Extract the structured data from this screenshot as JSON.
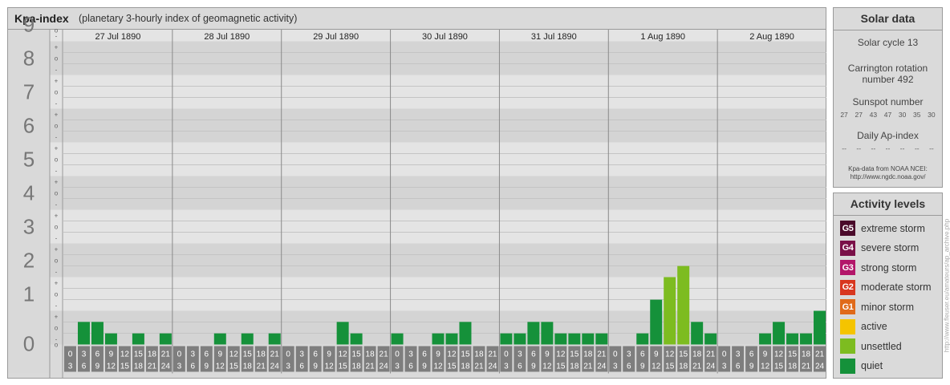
{
  "header": {
    "title": "Kpa-index",
    "subtitle": "(planetary 3-hourly index of geomagnetic activity)"
  },
  "chart_data": {
    "type": "bar",
    "ylim": [
      0,
      9
    ],
    "y_tick_labels": [
      "0",
      "1",
      "2",
      "3",
      "4",
      "5",
      "6",
      "7",
      "8",
      "9"
    ],
    "sub_tick_labels": [
      "-",
      "o",
      "+"
    ],
    "day_labels": [
      "27 Jul 1890",
      "28 Jul 1890",
      "29 Jul 1890",
      "30 Jul 1890",
      "31 Jul 1890",
      "1 Aug 1890",
      "2 Aug 1890"
    ],
    "interval_start_labels": [
      "0",
      "3",
      "6",
      "9",
      "12",
      "15",
      "18",
      "21"
    ],
    "interval_end_labels": [
      "3",
      "6",
      "9",
      "12",
      "15",
      "18",
      "21",
      "24"
    ],
    "values": [
      [
        0,
        0.67,
        0.67,
        0.33,
        0,
        0.33,
        0,
        0.33
      ],
      [
        0,
        0,
        0,
        0.33,
        0,
        0.33,
        0,
        0.33
      ],
      [
        0,
        0,
        0,
        0,
        0.67,
        0.33,
        0,
        0
      ],
      [
        0.33,
        0,
        0,
        0.33,
        0.33,
        0.67,
        0,
        0
      ],
      [
        0.33,
        0.33,
        0.67,
        0.67,
        0.33,
        0.33,
        0.33,
        0.33
      ],
      [
        0,
        0,
        0.33,
        1.33,
        2,
        2.33,
        0.67,
        0.33
      ],
      [
        0,
        0,
        0,
        0.33,
        0.67,
        0.33,
        0.33,
        1
      ]
    ],
    "level_colors": {
      "quiet": "#15913a",
      "unsettled": "#7dbc20"
    },
    "grid": true
  },
  "solar": {
    "title": "Solar data",
    "solar_cycle": "Solar cycle 13",
    "carrington_line1": "Carrington rotation",
    "carrington_line2": "number 492",
    "sunspot_label": "Sunspot number",
    "sunspot_values": [
      "27",
      "27",
      "43",
      "47",
      "30",
      "35",
      "30"
    ],
    "ap_label": "Daily Ap-index",
    "ap_values": [
      "--",
      "--",
      "--",
      "--",
      "--",
      "--",
      "--"
    ],
    "credit_line1": "Kpa-data from NOAA NCEI:",
    "credit_line2": "http://www.ngdc.noaa.gov/"
  },
  "activity": {
    "title": "Activity levels",
    "items": [
      {
        "badge": "G5",
        "label": "extreme storm",
        "color": "#4a0a2a"
      },
      {
        "badge": "G4",
        "label": "severe storm",
        "color": "#7a1048"
      },
      {
        "badge": "G3",
        "label": "strong storm",
        "color": "#b3166a"
      },
      {
        "badge": "G2",
        "label": "moderate storm",
        "color": "#d8371f"
      },
      {
        "badge": "G1",
        "label": "minor storm",
        "color": "#e06a1a"
      },
      {
        "badge": "",
        "label": "active",
        "color": "#f5c400"
      },
      {
        "badge": "",
        "label": "unsettled",
        "color": "#7dbc20"
      },
      {
        "badge": "",
        "label": "quiet",
        "color": "#15913a"
      }
    ]
  },
  "side_url": "http://www.fleuser.eu/amateurs/ap_archive.php"
}
